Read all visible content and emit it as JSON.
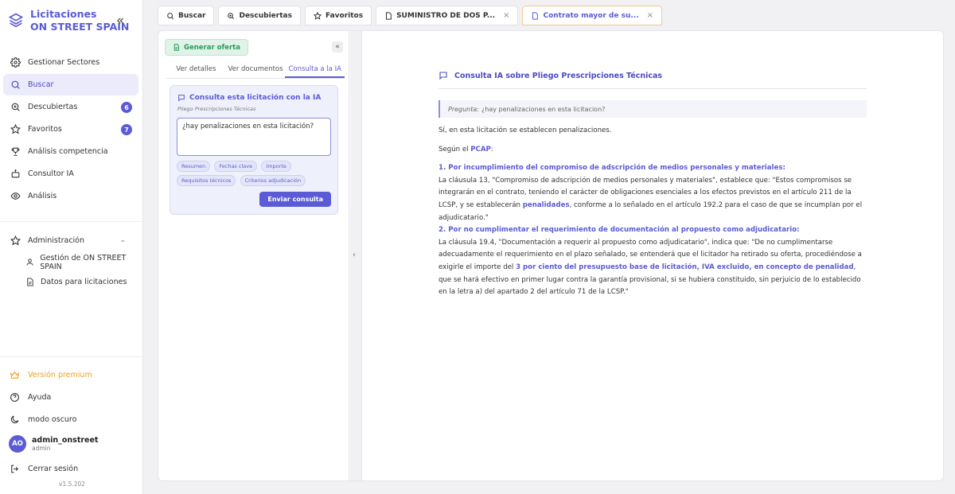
{
  "brand": {
    "line1": "Licitaciones",
    "line2": "ON STREET SPAIN"
  },
  "colors": {
    "accent": "#5b5bd6",
    "premium": "#f0a020",
    "green": "#2c9a5a",
    "active_tab_border": "#f2c98a"
  },
  "sidebar": {
    "items": [
      {
        "label": "Gestionar Sectores",
        "icon": "gear-icon"
      },
      {
        "label": "Buscar",
        "icon": "search-icon",
        "active": true
      },
      {
        "label": "Descubiertas",
        "icon": "zoom-plus-icon",
        "badge": "6"
      },
      {
        "label": "Favoritos",
        "icon": "star-icon",
        "badge": "7"
      },
      {
        "label": "Análisis competencia",
        "icon": "trophy-icon"
      },
      {
        "label": "Consultor IA",
        "icon": "robot-icon"
      },
      {
        "label": "Análisis",
        "icon": "eye-icon"
      }
    ],
    "admin": {
      "label": "Administración",
      "children": [
        {
          "label": "Gestión de ON STREET SPAIN"
        },
        {
          "label": "Datos para licitaciones"
        }
      ]
    },
    "bottom": {
      "premium": "Versión premium",
      "help": "Ayuda",
      "dark": "modo oscuro",
      "user_initials": "AO",
      "user_name": "admin_onstreet",
      "user_role": "admin",
      "logout": "Cerrar sesión",
      "version": "v1.5.202"
    }
  },
  "tabs": [
    {
      "label": "Buscar",
      "icon": "search-icon"
    },
    {
      "label": "Descubiertas",
      "icon": "zoom-plus-icon"
    },
    {
      "label": "Favoritos",
      "icon": "star-icon"
    },
    {
      "label": "SUMINISTRO DE DOS P...",
      "icon": "document-icon",
      "closable": true
    },
    {
      "label": "Contrato mayor de su...",
      "icon": "document-icon",
      "closable": true,
      "active": true
    }
  ],
  "left_panel": {
    "generate_label": "Generar oferta",
    "tabs": [
      "Ver detalles",
      "Ver documentos",
      "Consulta a la IA"
    ],
    "ia": {
      "title": "Consulta esta licitación con la IA",
      "subtitle": "Pliego Prescripciones Técnicas",
      "input_value": "¿hay penalizaciones en esta licitación?",
      "chips": [
        "Resumen",
        "Fechas clave",
        "Importe",
        "Requisitos técnicos",
        "Criterios adjudicación"
      ],
      "send_label": "Enviar consulta"
    }
  },
  "right_panel": {
    "title": "Consulta IA sobre Pliego Prescripciones Técnicas",
    "question_label": "Pregunta:",
    "question_text": "¿hay penalizaciones en esta licitacion?",
    "intro": "Sí, en esta licitación se establecen penalizaciones.",
    "segun_pre": "Según el ",
    "segun_hl": "PCAP",
    "segun_post": ":",
    "s1_heading": "1. Por incumplimiento del compromiso de adscripción de medios personales y materiales:",
    "s1_pre": "La cláusula 13, \"Compromiso de adscripción de medios personales y materiales\", establece que: \"Estos compromisos se integrarán en el contrato, teniendo el carácter de obligaciones esenciales a los efectos previstos en el artículo 211 de la LCSP, y se establecerán ",
    "s1_hl": "penalidades",
    "s1_post": ", conforme a lo señalado en el artículo 192.2 para el caso de que se incumplan por el adjudicatario.\"",
    "s2_heading": "2. Por no cumplimentar el requerimiento de documentación al propuesto como adjudicatario:",
    "s2_pre": "La cláusula 19.4, \"Documentación a requerir al propuesto como adjudicatario\", indica que: \"De no cumplimentarse adecuadamente el requerimiento en el plazo señalado, se entenderá que el licitador ha retirado su oferta, procediéndose a exigirle el importe del ",
    "s2_hl": "3 por ciento del presupuesto base de licitación, IVA excluido, en concepto de penalidad",
    "s2_post": ", que se hará efectivo en primer lugar contra la garantía provisional, si se hubiera constituido, sin perjuicio de lo establecido en la letra a) del apartado 2 del artículo 71 de la LCSP.\""
  }
}
